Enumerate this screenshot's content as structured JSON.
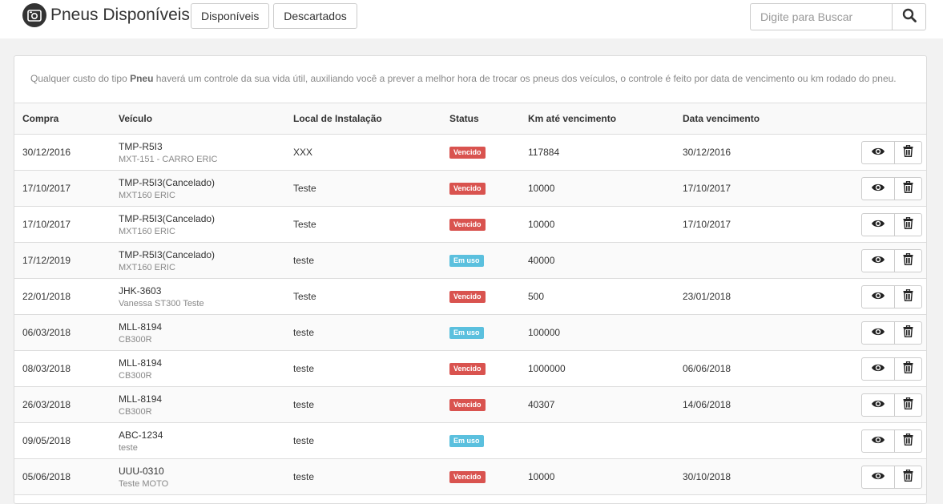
{
  "header": {
    "title": "Pneus Disponíveis",
    "icon": "camera-icon",
    "tabs": [
      {
        "label": "Disponíveis"
      },
      {
        "label": "Descartados"
      }
    ],
    "search": {
      "placeholder": "Digite para Buscar",
      "value": "",
      "icon": "search-icon"
    }
  },
  "info": {
    "prefix": "Qualquer custo do tipo ",
    "highlight": "Pneu",
    "suffix": " haverá um controle da sua vida útil, auxiliando você a prever a melhor hora de trocar os pneus dos veículos, o controle é feito por data de vencimento ou km rodado do pneu."
  },
  "table": {
    "columns": [
      "Compra",
      "Veículo",
      "Local de Instalação",
      "Status",
      "Km até vencimento",
      "Data vencimento"
    ],
    "rows": [
      {
        "compra": "30/12/2016",
        "veiculo": "TMP-R5I3",
        "veiculo_sub": "MXT-151 - CARRO ERIC",
        "local": "XXX",
        "status": "Vencido",
        "km": "117884",
        "data": "30/12/2016"
      },
      {
        "compra": "17/10/2017",
        "veiculo": "TMP-R5I3(Cancelado)",
        "veiculo_sub": "MXT160 ERIC",
        "local": "Teste",
        "status": "Vencido",
        "km": "10000",
        "data": "17/10/2017"
      },
      {
        "compra": "17/10/2017",
        "veiculo": "TMP-R5I3(Cancelado)",
        "veiculo_sub": "MXT160 ERIC",
        "local": "Teste",
        "status": "Vencido",
        "km": "10000",
        "data": "17/10/2017"
      },
      {
        "compra": "17/12/2019",
        "veiculo": "TMP-R5I3(Cancelado)",
        "veiculo_sub": "MXT160 ERIC",
        "local": "teste",
        "status": "Em uso",
        "km": "40000",
        "data": ""
      },
      {
        "compra": "22/01/2018",
        "veiculo": "JHK-3603",
        "veiculo_sub": "Vanessa ST300 Teste",
        "local": "Teste",
        "status": "Vencido",
        "km": "500",
        "data": "23/01/2018"
      },
      {
        "compra": "06/03/2018",
        "veiculo": "MLL-8194",
        "veiculo_sub": "CB300R",
        "local": "teste",
        "status": "Em uso",
        "km": "100000",
        "data": ""
      },
      {
        "compra": "08/03/2018",
        "veiculo": "MLL-8194",
        "veiculo_sub": "CB300R",
        "local": "teste",
        "status": "Vencido",
        "km": "1000000",
        "data": "06/06/2018"
      },
      {
        "compra": "26/03/2018",
        "veiculo": "MLL-8194",
        "veiculo_sub": "CB300R",
        "local": "teste",
        "status": "Vencido",
        "km": "40307",
        "data": "14/06/2018"
      },
      {
        "compra": "09/05/2018",
        "veiculo": "ABC-1234",
        "veiculo_sub": "teste",
        "local": "teste",
        "status": "Em uso",
        "km": "",
        "data": ""
      },
      {
        "compra": "05/06/2018",
        "veiculo": "UUU-0310",
        "veiculo_sub": "Teste MOTO",
        "local": "teste",
        "status": "Vencido",
        "km": "10000",
        "data": "30/10/2018"
      }
    ]
  },
  "colors": {
    "vencido": "#d9534f",
    "em_uso": "#5bc0de"
  },
  "row_actions": {
    "view_icon": "eye-icon",
    "delete_icon": "trash-icon"
  }
}
